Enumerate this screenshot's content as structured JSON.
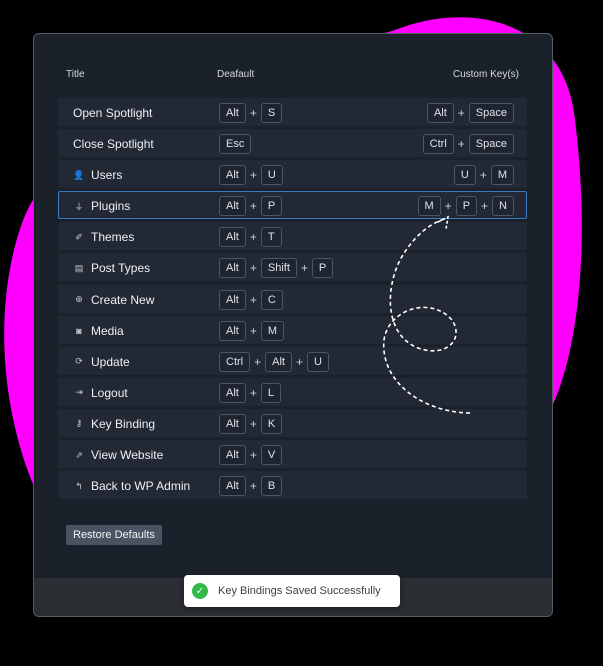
{
  "header": {
    "title": "Title",
    "default": "Deafault",
    "custom": "Custom Key(s)"
  },
  "rows": [
    {
      "label": "Open Spotlight",
      "icon": "",
      "default": [
        "Alt",
        "S"
      ],
      "custom": [
        "Alt",
        "Space"
      ]
    },
    {
      "label": "Close Spotlight",
      "icon": "",
      "default": [
        "Esc"
      ],
      "custom": [
        "Ctrl",
        "Space"
      ]
    },
    {
      "label": "Users",
      "icon": "user-icon",
      "default": [
        "Alt",
        "U"
      ],
      "custom": [
        "U",
        "M"
      ]
    },
    {
      "label": "Plugins",
      "icon": "plug-icon",
      "default": [
        "Alt",
        "P"
      ],
      "custom": [
        "M",
        "P",
        "N"
      ],
      "selected": true
    },
    {
      "label": "Themes",
      "icon": "brush-icon",
      "default": [
        "Alt",
        "T"
      ],
      "custom": []
    },
    {
      "label": "Post Types",
      "icon": "document-icon",
      "default": [
        "Alt",
        "Shift",
        "P"
      ],
      "custom": []
    },
    {
      "label": "Create New",
      "icon": "plus-circle-icon",
      "default": [
        "Alt",
        "C"
      ],
      "custom": []
    },
    {
      "label": "Media",
      "icon": "camera-icon",
      "default": [
        "Alt",
        "M"
      ],
      "custom": []
    },
    {
      "label": "Update",
      "icon": "refresh-icon",
      "default": [
        "Ctrl",
        "Alt",
        "U"
      ],
      "custom": []
    },
    {
      "label": "Logout",
      "icon": "logout-icon",
      "default": [
        "Alt",
        "L"
      ],
      "custom": []
    },
    {
      "label": "Key Binding",
      "icon": "key-icon",
      "default": [
        "Alt",
        "K"
      ],
      "custom": []
    },
    {
      "label": "View Website",
      "icon": "external-link-icon",
      "default": [
        "Alt",
        "V"
      ],
      "custom": []
    },
    {
      "label": "Back to WP Admin",
      "icon": "back-arrow-icon",
      "default": [
        "Alt",
        "B"
      ],
      "custom": []
    }
  ],
  "plus_sign": "+",
  "restore_label": "Restore Defaults",
  "toast": {
    "message": "Key Bindings Saved Successfully",
    "icon": "check-circle-icon"
  },
  "colors": {
    "blob": "#ff00ff",
    "panel": "#1b212b",
    "row": "#222935",
    "selected_border": "#3a7bc0",
    "toast_check": "#34b84a"
  }
}
